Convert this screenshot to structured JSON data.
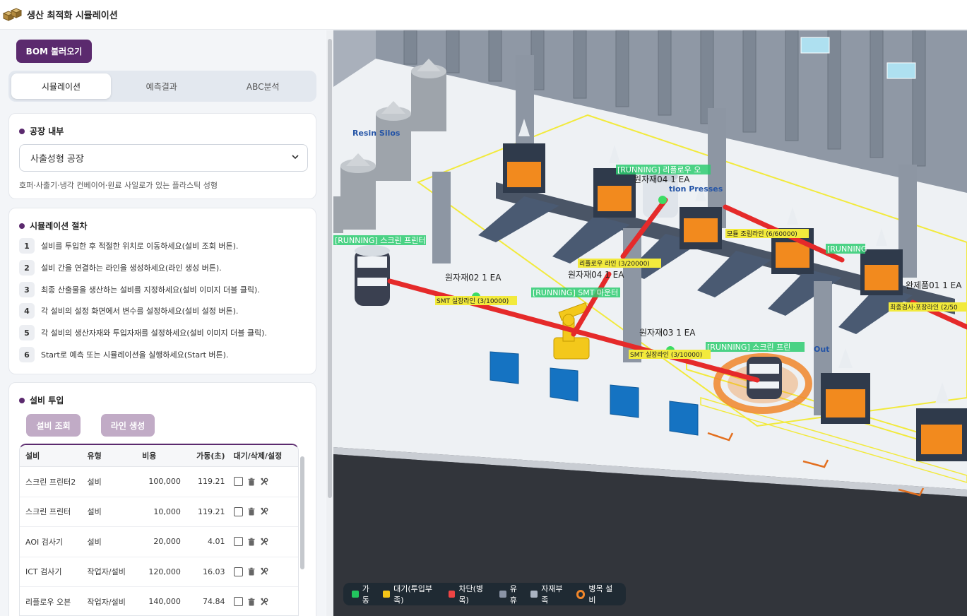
{
  "app": {
    "title": "생산 최적화 시뮬레이션"
  },
  "toolbar": {
    "bom_label": "BOM 불러오기"
  },
  "tabs": [
    {
      "label": "시뮬레이션",
      "active": true
    },
    {
      "label": "예측결과",
      "active": false
    },
    {
      "label": "ABC분석",
      "active": false
    }
  ],
  "factory": {
    "title": "공장 내부",
    "selected": "사출성형 공장",
    "description": "호퍼·사출기·냉각 컨베이어·원료 사일로가 있는 플라스틱 성형"
  },
  "procedure": {
    "title": "시뮬레이션 절차",
    "steps": [
      {
        "num": "1",
        "text": "설비를 투입한 후 적절한 위치로 이동하세요(설비 조회 버튼)."
      },
      {
        "num": "2",
        "text": "설비 간을 연결하는 라인을 생성하세요(라인 생성 버튼)."
      },
      {
        "num": "3",
        "text": "최종 산출물을 생산하는 설비를 지정하세요(설비 이미지 더블 클릭)."
      },
      {
        "num": "4",
        "text": "각 설비의 설정 화면에서 변수를 설정하세요(설비 설정 버튼)."
      },
      {
        "num": "5",
        "text": "각 설비의 생산자재와 투입자재를 설정하세요(설비 이미지 더블 클릭)."
      },
      {
        "num": "6",
        "text": "Start로 예측 또는 시뮬레이션을 실행하세요(Start 버튼)."
      }
    ]
  },
  "equipment": {
    "title": "설비 투입",
    "lookup_label": "설비 조회",
    "line_label": "라인 생성",
    "headers": [
      "설비",
      "유형",
      "비용",
      "가동(초)",
      "대기/삭제/설정"
    ],
    "rows": [
      {
        "name": "스크린 프린터2",
        "type": "설비",
        "cost": "100,000",
        "time": "119.21"
      },
      {
        "name": "스크린 프린터",
        "type": "설비",
        "cost": "10,000",
        "time": "119.21"
      },
      {
        "name": "AOI 검사기",
        "type": "설비",
        "cost": "20,000",
        "time": "4.01"
      },
      {
        "name": "ICT 검사기",
        "type": "작업자/설비",
        "cost": "120,000",
        "time": "16.03"
      },
      {
        "name": "리플로우 오븐",
        "type": "작업자/설비",
        "cost": "140,000",
        "time": "74.84"
      }
    ]
  },
  "scene": {
    "labels": {
      "resin": "Resin Silos",
      "presses": "tion Presses",
      "out": "Out",
      "run_screen1": "[RUNNING] 스크린 프린터",
      "run_reflow": "[RUNNING] 리플로우 오",
      "run_smt": "[RUNNING] SMT 마운터",
      "run_screen2": "[RUNNING] 스크린 프린",
      "run_partial": "[RUNNING",
      "mat04a": "원자재04 1 EA",
      "mat02": "원자재02 1 EA",
      "mat04b": "원자재04 1 EA",
      "mat03": "원자재03 1 EA",
      "fin01": "완제품01 1 EA",
      "line_reflow": "리플로우 라인 (3/20000)",
      "line_smt1": "SMT 실장라인 (3/10000)",
      "line_smt2": "SMT 실장라인 (3/10000)",
      "line_module": "모듈 조립라인 (6/60000)",
      "line_final": "최종검사·포장라인 (2/50"
    }
  },
  "legend": {
    "items": [
      {
        "label": "가동",
        "color": "#22c55e"
      },
      {
        "label": "대기(투입부족)",
        "color": "#f5c518"
      },
      {
        "label": "차단(병목)",
        "color": "#ef4444"
      },
      {
        "label": "유휴",
        "color": "#8a94a6"
      },
      {
        "label": "자재부족",
        "color": "#aab3c2"
      },
      {
        "label": "병목 설비",
        "color": "#f0862a"
      }
    ]
  }
}
